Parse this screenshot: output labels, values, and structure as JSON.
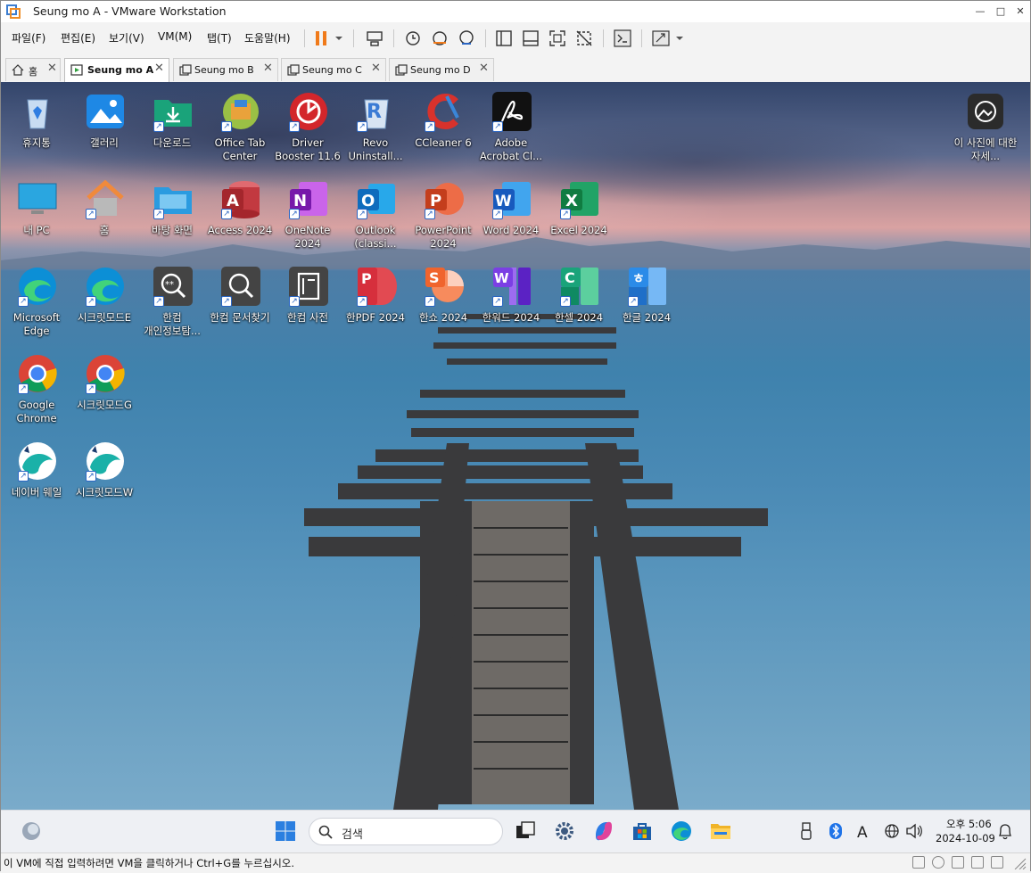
{
  "window": {
    "title": "Seung mo A - VMware Workstation"
  },
  "menu": [
    "파일(F)",
    "편집(E)",
    "보기(V)",
    "VM(M)",
    "탭(T)",
    "도움말(H)"
  ],
  "tabs": [
    {
      "label": "홈",
      "icon": "home-icon",
      "active": false
    },
    {
      "label": "Seung mo A",
      "icon": "vm-running-icon",
      "active": true
    },
    {
      "label": "Seung mo B",
      "icon": "vm-icon",
      "active": false
    },
    {
      "label": "Seung mo C",
      "icon": "vm-icon",
      "active": false
    },
    {
      "label": "Seung mo D",
      "icon": "vm-icon",
      "active": false
    }
  ],
  "desktop": {
    "icons": [
      {
        "label": "휴지통",
        "icon": "recycle-bin-icon",
        "color": "#7aa7d8",
        "shortcut": false
      },
      {
        "label": "갤러리",
        "icon": "gallery-icon",
        "color": "#1e88e5",
        "shortcut": false
      },
      {
        "label": "다운로드",
        "icon": "downloads-folder-icon",
        "color": "#1aa37a",
        "shortcut": true
      },
      {
        "label": "Office Tab Center",
        "icon": "office-tab-icon",
        "color": "#e9a23b",
        "shortcut": true
      },
      {
        "label": "Driver Booster 11.6",
        "icon": "driver-booster-icon",
        "color": "#d3262b",
        "shortcut": true
      },
      {
        "label": "Revo Uninstall...",
        "icon": "revo-uninstaller-icon",
        "color": "#3a7bd5",
        "shortcut": true
      },
      {
        "label": "CCleaner 6",
        "icon": "ccleaner-icon",
        "color": "#d8322c",
        "shortcut": true
      },
      {
        "label": "Adobe Acrobat Cl...",
        "icon": "adobe-acrobat-icon",
        "color": "#111111",
        "shortcut": true
      },
      {
        "label": "이 사진에 대한 자세...",
        "icon": "spotlight-icon",
        "color": "#2b2b2b",
        "shortcut": false
      },
      {
        "label": "내 PC",
        "icon": "this-pc-icon",
        "color": "#2aa6e0",
        "shortcut": false
      },
      {
        "label": "홈",
        "icon": "home-icon",
        "color": "#f08a3c",
        "shortcut": true
      },
      {
        "label": "바탕 화면",
        "icon": "desktop-folder-icon",
        "color": "#2b9be0",
        "shortcut": true
      },
      {
        "label": "Access 2024",
        "icon": "access-icon",
        "color": "#a4262c",
        "shortcut": true
      },
      {
        "label": "OneNote 2024",
        "icon": "onenote-icon",
        "color": "#7719aa",
        "shortcut": true
      },
      {
        "label": "Outlook (classi...",
        "icon": "outlook-icon",
        "color": "#0f6cbd",
        "shortcut": true
      },
      {
        "label": "PowerPoint 2024",
        "icon": "powerpoint-icon",
        "color": "#d35230",
        "shortcut": true
      },
      {
        "label": "Word 2024",
        "icon": "word-icon",
        "color": "#185abd",
        "shortcut": true
      },
      {
        "label": "Excel 2024",
        "icon": "excel-icon",
        "color": "#107c41",
        "shortcut": true
      },
      {
        "label": "Microsoft Edge",
        "icon": "edge-icon",
        "color": "#0c8fd6",
        "shortcut": true
      },
      {
        "label": "시크릿모드E",
        "icon": "edge-icon",
        "color": "#0c8fd6",
        "shortcut": true
      },
      {
        "label": "한컴 개인정보탐...",
        "icon": "hancom-privacy-icon",
        "color": "#444444",
        "shortcut": true
      },
      {
        "label": "한컴 문서찾기",
        "icon": "hancom-search-icon",
        "color": "#444444",
        "shortcut": true
      },
      {
        "label": "한컴 사전",
        "icon": "hancom-dictionary-icon",
        "color": "#444444",
        "shortcut": true
      },
      {
        "label": "한PDF 2024",
        "icon": "hanpdf-icon",
        "color": "#d62f3c",
        "shortcut": true
      },
      {
        "label": "한쇼 2024",
        "icon": "hanshow-icon",
        "color": "#f0642d",
        "shortcut": true
      },
      {
        "label": "한워드 2024",
        "icon": "hanword-icon",
        "color": "#7b3fe4",
        "shortcut": true
      },
      {
        "label": "한셀 2024",
        "icon": "hancell-icon",
        "color": "#1aa37a",
        "shortcut": true
      },
      {
        "label": "한글 2024",
        "icon": "hangul-icon",
        "color": "#2b8be8",
        "shortcut": true
      },
      {
        "label": "Google Chrome",
        "icon": "chrome-icon",
        "color": "#4285f4",
        "shortcut": true
      },
      {
        "label": "시크릿모드G",
        "icon": "chrome-icon",
        "color": "#4285f4",
        "shortcut": true
      },
      {
        "label": "네이버 웨일",
        "icon": "whale-icon",
        "color": "#1ab1a8",
        "shortcut": true
      },
      {
        "label": "시크릿모드W",
        "icon": "whale-icon",
        "color": "#1ab1a8",
        "shortcut": true
      }
    ]
  },
  "taskbar": {
    "search_placeholder": "검색",
    "time": "오후 5:06",
    "date": "2024-10-09"
  },
  "status": {
    "text": "이 VM에 직접 입력하려면 VM을 클릭하거나 Ctrl+G를 누르십시오."
  },
  "colors": {
    "pause_accent": "#f07a1a",
    "accent": "#2b66c3"
  }
}
